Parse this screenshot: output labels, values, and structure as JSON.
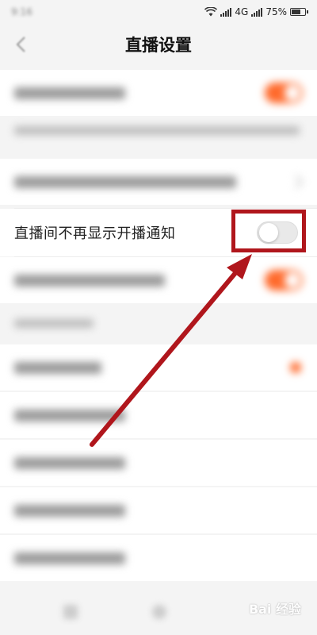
{
  "status_bar": {
    "time": "9:16",
    "network": "4G",
    "battery_percent": "75%",
    "battery_level": 0.75
  },
  "header": {
    "title": "直播设置",
    "back_icon": "chevron-left-icon"
  },
  "settings": {
    "highlighted_item": {
      "label": "直播间不再显示开播通知",
      "enabled": false
    }
  },
  "colors": {
    "accent": "#ff6a2c",
    "highlight": "#b0161c",
    "background": "#f4f4f4"
  },
  "watermark": {
    "text": "Bai 经验"
  }
}
